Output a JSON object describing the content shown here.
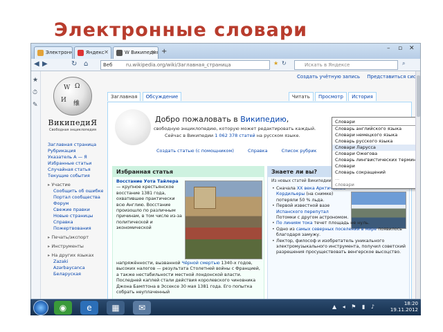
{
  "slide": {
    "title": "Электронные словари"
  },
  "browser": {
    "tabs": [
      {
        "label": "Электронные",
        "icon": "bookmark-icon",
        "color": "#e2a23a"
      },
      {
        "label": "Яндекс",
        "icon": "yandex-icon",
        "color": "#d33"
      },
      {
        "label": "W Википедия — свобод...",
        "icon": "wikipedia-icon",
        "color": "#555"
      }
    ],
    "new_tab": "+",
    "window_controls": {
      "minimize": "–",
      "maximize": "▫",
      "close": "✕"
    },
    "nav": {
      "back": "◀",
      "forward": "▶",
      "reload": "↻",
      "home": "⌂"
    },
    "url_site": "Веб",
    "url": "ru.wikipedia.org/wiki/Заглавная_страница",
    "search_placeholder": "Искать в Яндексе",
    "side_icons": [
      "★",
      "⏱",
      "✎"
    ]
  },
  "wiki": {
    "user_tools": [
      "Создать учётную запись",
      "Представиться системе"
    ],
    "logo_name": "ВикипедиЯ",
    "logo_sub": "Свободная энциклопедия",
    "nav_links": [
      "Заглавная страница",
      "Рубрикация",
      "Указатель А — Я",
      "Избранные статьи",
      "Случайная статья",
      "Текущие события"
    ],
    "sections": [
      {
        "label": "Участие",
        "items": [
          "Сообщить об ошибке",
          "Портал сообщества",
          "Форум",
          "Свежие правки",
          "Новые страницы",
          "Справка",
          "Пожертвования"
        ]
      },
      {
        "label": "Печать/экспорт",
        "items": []
      },
      {
        "label": "Инструменты",
        "items": []
      },
      {
        "label": "На других языках",
        "items": [
          "Zazaki",
          "Azərbaycanca",
          "Беларуская"
        ]
      }
    ],
    "tabs_left": [
      "Заглавная",
      "Обсуждение"
    ],
    "tabs_right": [
      "Читать",
      "Просмотр",
      "История"
    ],
    "welcome_prefix": "Добро пожаловать в ",
    "welcome_link": "Википедию",
    "welcome_sub": "свободную энциклопедию, которую может редактировать каждый.",
    "count_prefix": "Сейчас в Википедии ",
    "count_link": "1 062 378 статей",
    "count_suffix": " на русском языке.",
    "welcome_links": [
      "Создать статью (с помощником)",
      "Справка",
      "Список рубрик"
    ],
    "featured": {
      "title": "Избранная статья",
      "link": "Восстание Уота Тайлера",
      "text": "— крупное крестьянское восстание 1381 года, охватившее практически всю Англию. Восстание произошло по различным причинам, в том числе из-за политической и экономической",
      "more_prefix": "напряжённости, вызванной ",
      "more_link": "Чёрной смертью",
      "more_text": " 1340-х годов, высоких налогов — результата Столетней войны с Францией, а также нестабильности местной лондонской власти. Последней каплей стали действия королевского чиновника Джона Бамптона в Эссексе 30 мая 1381 года. Его попытка собрать неуплаченный"
    },
    "dyk": {
      "title": "Знаете ли вы?",
      "intro": "Из новых статей Википедии:",
      "items": [
        {
          "pre": "Сначала ",
          "link": "XX века Арктические Кордильеры",
          "post": " (на снимке) потеряли 50 % льда."
        },
        {
          "pre": "Первой известной вазе ",
          "link": "Испанского перепутал",
          "post": " Потомки с другом астрономом."
        },
        {
          "pre": "",
          "link": "По линиям тока",
          "post": " течет площадь не нуль."
        },
        {
          "pre": "Одно из ",
          "link": "самых северных поселений в мире",
          "post": " появилось благодаря замужу."
        },
        {
          "pre": "Лектор, философ и изобретатель ",
          "link": "",
          "post": "уникального электромузыкального инструмента, получил советский разрешения просуществовать венгерское высоцство."
        }
      ]
    },
    "dropdown": {
      "input": "Словари",
      "options": [
        "Словарь английского языка",
        "Словари немецкого языка",
        "Словарь русского языка",
        "Словари Ларусса",
        "Словари Ожегова",
        "Словарь лингвистических терминов",
        "Словари",
        "Словарь сокращений"
      ],
      "tail": [
        "...",
        "словари"
      ]
    }
  },
  "taskbar": {
    "apps": [
      "◉",
      "e",
      "▦",
      "✉"
    ],
    "tray_icons": "▲ ◂ ⚑ ▮ ♪",
    "time": "18:20",
    "date": "19.11.2012"
  }
}
